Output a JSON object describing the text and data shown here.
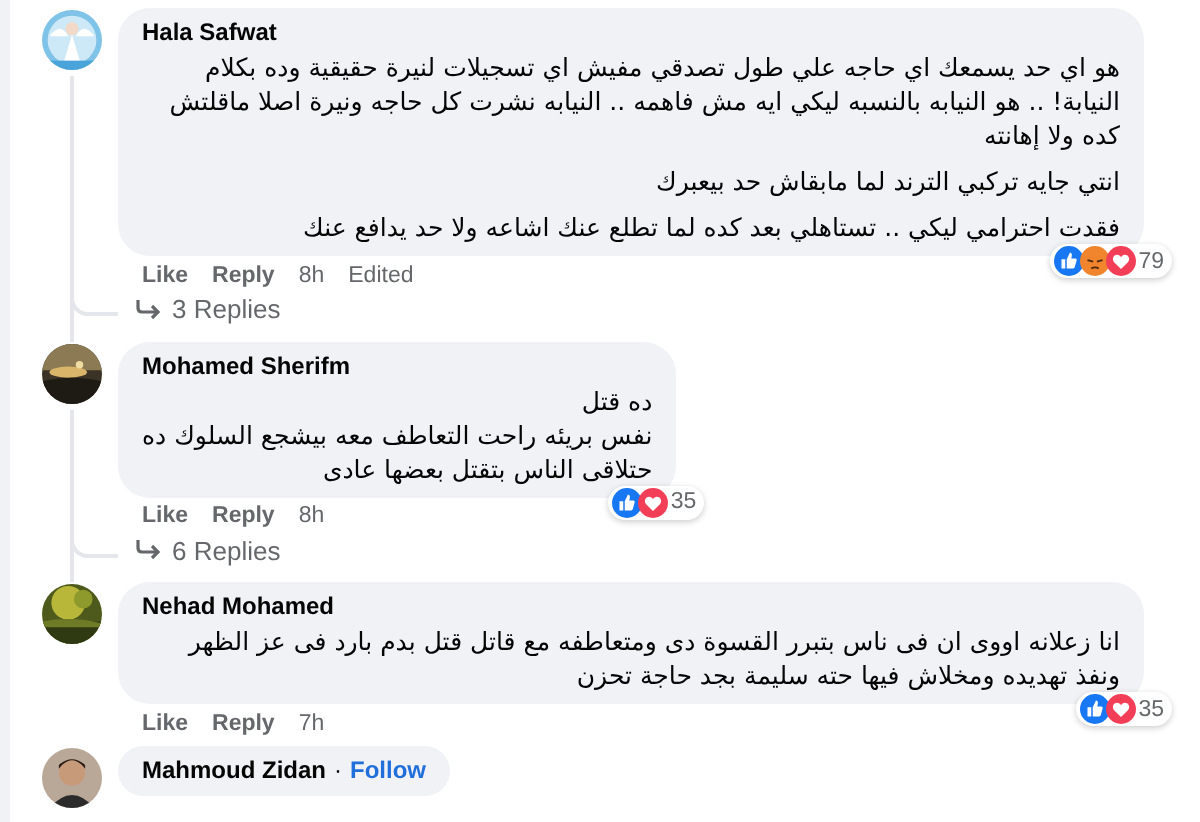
{
  "comments": [
    {
      "author": "Hala Safwat",
      "paragraphs": [
        "هو اي حد يسمعك اي حاجه علي طول تصدقي مفيش اي تسجيلات لنيرة حقيقية وده بكلام النيابة! .. هو النيابه بالنسبه ليكي ايه مش فاهمه .. النيابه نشرت كل حاجه ونيرة اصلا ماقلتش كده ولا إهانته",
        "انتي جايه تركبي الترند لما مابقاش حد بيعبرك",
        "فقدت احترامي ليكي .. تستاهلي بعد كده لما تطلع عنك اشاعه ولا حد يدافع عنك"
      ],
      "like": "Like",
      "reply": "Reply",
      "time": "8h",
      "edited": "Edited",
      "reactions": [
        {
          "kind": "like"
        },
        {
          "kind": "angry"
        },
        {
          "kind": "love"
        }
      ],
      "count": "79",
      "replies": "3 Replies"
    },
    {
      "author": "Mohamed Sherifm",
      "paragraphs": [
        "ده قتل\nنفس بريئه راحت التعاطف معه بيشجع السلوك ده\nحتلاقى الناس بتقتل بعضها عادى"
      ],
      "like": "Like",
      "reply": "Reply",
      "time": "8h",
      "reactions": [
        {
          "kind": "like"
        },
        {
          "kind": "love"
        }
      ],
      "count": "35",
      "replies": "6 Replies"
    },
    {
      "author": "Nehad Mohamed",
      "paragraphs": [
        "انا زعلانه اووى ان فى ناس بتبرر القسوة دى ومتعاطفه مع قاتل قتل بدم بارد فى عز الظهر ونفذ تهديده ومخلاش فيها حته سليمة بجد حاجة تحزن"
      ],
      "like": "Like",
      "reply": "Reply",
      "time": "7h",
      "reactions": [
        {
          "kind": "like"
        },
        {
          "kind": "love"
        }
      ],
      "count": "35"
    },
    {
      "author": "Mahmoud Zidan",
      "separator": "·",
      "follow": "Follow"
    }
  ]
}
